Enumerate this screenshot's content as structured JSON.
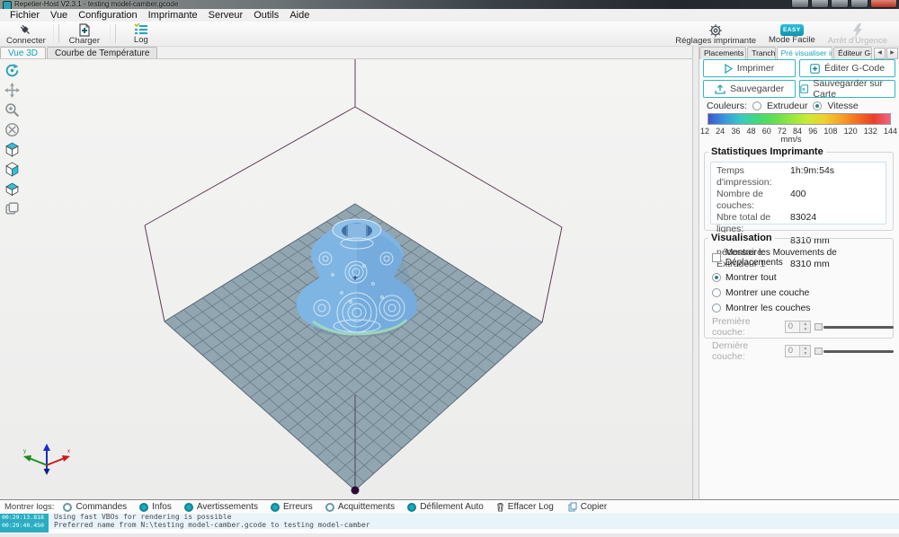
{
  "window": {
    "title": "Repetier-Host V2.3.1 - testing model-camber.gcode"
  },
  "menu": {
    "items": [
      "Fichier",
      "Vue",
      "Configuration",
      "Imprimante",
      "Serveur",
      "Outils",
      "Aide"
    ]
  },
  "toolbar": {
    "connect": "Connecter",
    "load": "Charger",
    "log": "Log",
    "printer_settings": "Réglages imprimante",
    "easy_mode": "Mode Facile",
    "easy_badge": "EASY",
    "emergency": "Arrêt d'Urgence"
  },
  "view_tabs": [
    "Vue 3D",
    "Courbe de Température"
  ],
  "right_tabs": [
    "Placements d'objets",
    "Trancheur",
    "Pré visualiser impression",
    "Éditeur G-Code"
  ],
  "actions": {
    "print": "Imprimer",
    "edit_gcode": "Éditer G-Code",
    "save": "Sauvegarder",
    "save_sd": "Sauvegarder sur Carte"
  },
  "colors_section": {
    "label": "Couleurs:",
    "extruder": "Extrudeur",
    "speed": "Vitesse",
    "selected": "Vitesse",
    "ticks": [
      "12",
      "24",
      "36",
      "48",
      "60",
      "72",
      "84",
      "96",
      "108",
      "120",
      "132",
      "144"
    ],
    "unit": "mm/s",
    "gradient": [
      "#4054cf",
      "#3898df",
      "#3cc9c1",
      "#43d878",
      "#62de52",
      "#96e740",
      "#c9ea37",
      "#f0d031",
      "#f5a428",
      "#f27021",
      "#e8402a",
      "#f26282"
    ]
  },
  "stats": {
    "title": "Statistiques Imprimante",
    "rows": [
      {
        "label": "Temps d'impression:",
        "value": "1h:9m:54s"
      },
      {
        "label": "Nombre de couches:",
        "value": "400"
      },
      {
        "label": "Nbre total de lignes:",
        "value": "83024"
      },
      {
        "label": "Filament nécessaire:",
        "value": "8310 mm"
      },
      {
        "label": "Extrudeur 1",
        "value": "8310 mm"
      }
    ]
  },
  "visualization": {
    "title": "Visualisation",
    "travel_checkbox": "Montrer les Mouvements de Déplacements",
    "show_all": "Montrer tout",
    "show_one": "Montrer une couche",
    "show_range": "Montrer les couches",
    "selected_radio": "Montrer tout",
    "first_layer_label": "Première couche:",
    "first_layer_value": "0",
    "last_layer_label": "Dernière couche:",
    "last_layer_value": "0"
  },
  "log": {
    "label": "Montrer logs:",
    "toggles": [
      {
        "label": "Commandes",
        "active": false
      },
      {
        "label": "Infos",
        "active": true
      },
      {
        "label": "Avertissements",
        "active": true
      },
      {
        "label": "Erreurs",
        "active": true
      },
      {
        "label": "Acquittements",
        "active": false
      },
      {
        "label": "Défilement Auto",
        "active": true
      }
    ],
    "clear": "Effacer Log",
    "copy": "Copier",
    "entries": [
      {
        "time": "00:29:13.818",
        "message": "Using fast VBOs for rendering is possible"
      },
      {
        "time": "00:29:40.450",
        "message": "Preferred name from N:\\testing model-camber.gcode to testing model-camber"
      }
    ]
  },
  "scene_colors": {
    "accent": "#1ba4b8",
    "wireframe": "#5d3c58",
    "bed_fill": "#8aa0ac",
    "bed_grid": "#50616e",
    "model_fill": "#7eb5e3",
    "corner_dot": "#2e0a38"
  }
}
